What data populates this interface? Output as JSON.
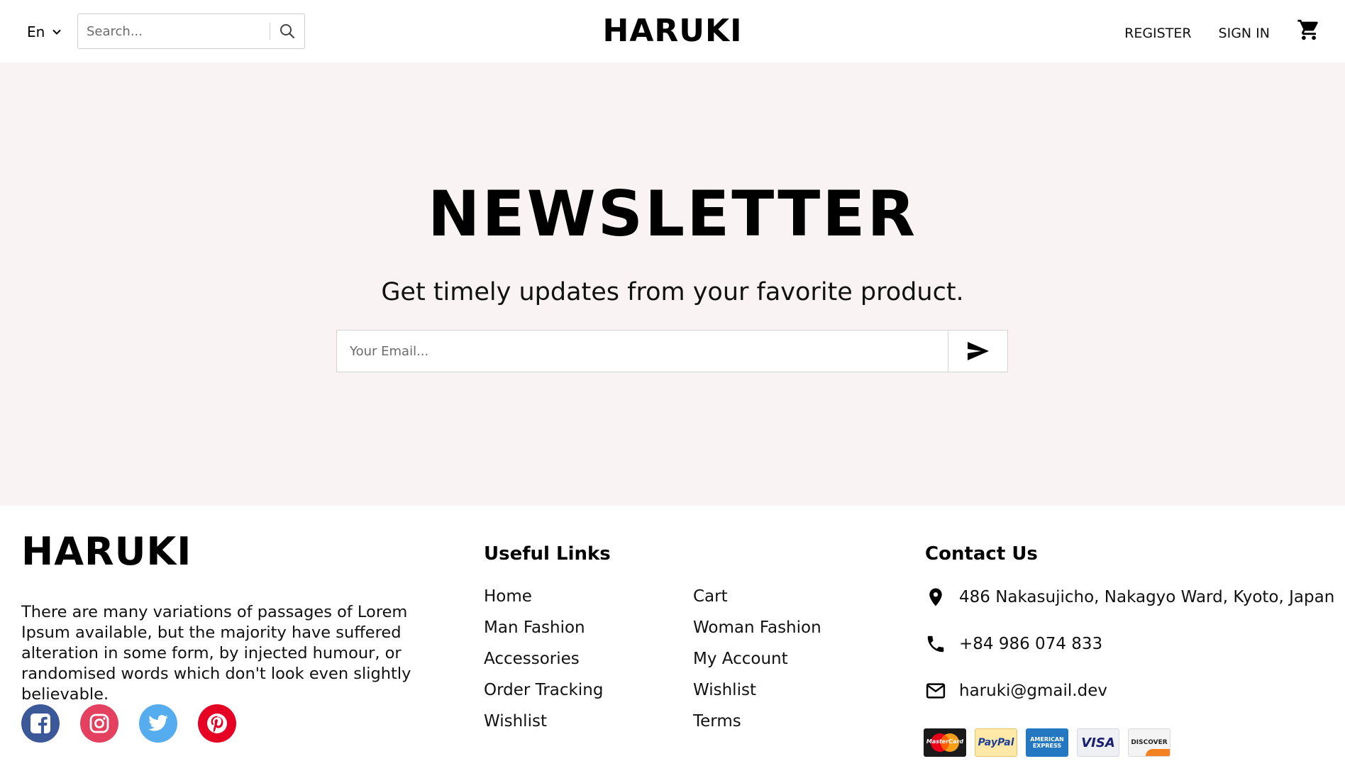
{
  "header": {
    "language": "En",
    "search_placeholder": "Search...",
    "logo": "HARUKI",
    "register_label": "REGISTER",
    "signin_label": "SIGN IN",
    "cart_icon": "cart-icon"
  },
  "newsletter": {
    "title": "NEWSLETTER",
    "subtitle": "Get timely updates from your favorite product.",
    "email_placeholder": "Your Email...",
    "send_icon": "send-icon",
    "background": "#f9f3f3"
  },
  "footer": {
    "logo": "HARUKI",
    "description": "There are many variations of passages of Lorem Ipsum available, but the majority have suffered alteration in some form, by injected humour, or randomised words which don't look even slightly believable.",
    "socials": [
      {
        "name": "facebook",
        "color": "#3b5998"
      },
      {
        "name": "instagram",
        "color": "#e4405f"
      },
      {
        "name": "twitter",
        "color": "#55acee"
      },
      {
        "name": "pinterest",
        "color": "#e60023"
      }
    ],
    "useful_links": {
      "title": "Useful Links",
      "col1": [
        "Home",
        "Man Fashion",
        "Accessories",
        "Order Tracking",
        "Wishlist"
      ],
      "col2": [
        "Cart",
        "Woman Fashion",
        "My Account",
        "Wishlist",
        "Terms"
      ]
    },
    "contact": {
      "title": "Contact Us",
      "address": "486 Nakasujicho, Nakagyo Ward, Kyoto, Japan",
      "phone": "+84 986 074 833",
      "email": "haruki@gmail.dev"
    },
    "payments": [
      {
        "name": "MasterCard",
        "label": "MasterCard"
      },
      {
        "name": "PayPal",
        "label": "PayPal"
      },
      {
        "name": "American Express",
        "label": "AMERICAN EXPRESS"
      },
      {
        "name": "Visa",
        "label": "VISA"
      },
      {
        "name": "Discover",
        "label": "DISCOVER"
      }
    ]
  }
}
